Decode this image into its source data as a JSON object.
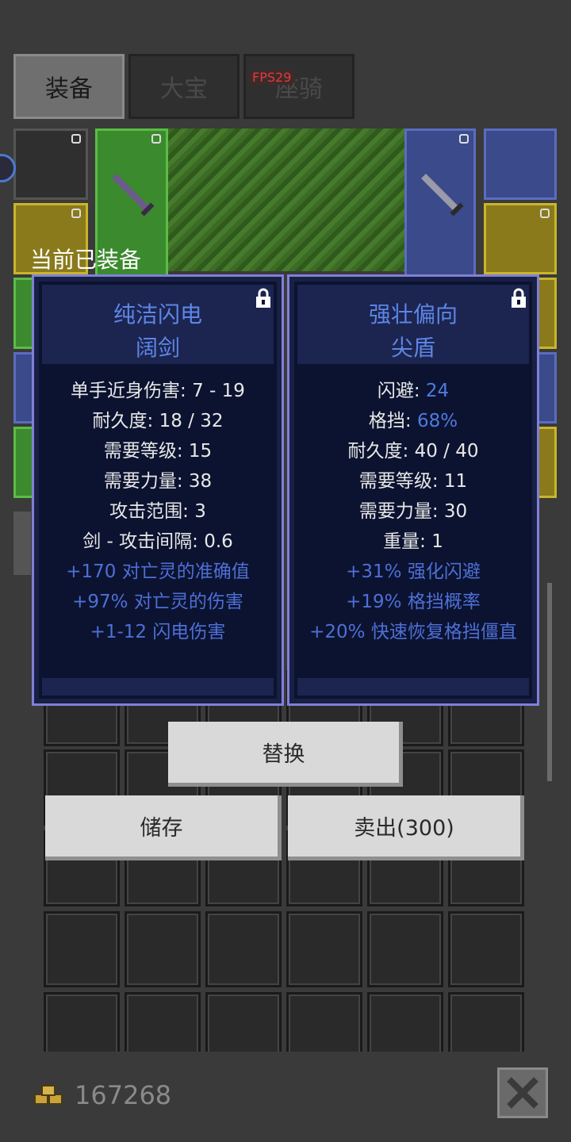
{
  "tabs": [
    {
      "label": "装备",
      "active": true
    },
    {
      "label": "大宝",
      "active": false
    },
    {
      "label": "座骑",
      "active": false
    }
  ],
  "fps": "FPS29",
  "popup": {
    "title": "当前已装备",
    "left_item": {
      "name_line1": "纯洁闪电",
      "name_line2": "阔剑",
      "stats": [
        {
          "text": "单手近身伤害: 7 - 19"
        },
        {
          "text": "耐久度: 18 / 32"
        },
        {
          "text": "需要等级: 15"
        },
        {
          "text": "需要力量: 38"
        },
        {
          "text": "攻击范围: 3"
        },
        {
          "text": "剑 - 攻击间隔: 0.6"
        }
      ],
      "mods": [
        "+170 对亡灵的准确值",
        "+97% 对亡灵的伤害",
        "+1-12 闪电伤害"
      ]
    },
    "right_item": {
      "name_line1": "强壮偏向",
      "name_line2": "尖盾",
      "stats": [
        {
          "label": "闪避: ",
          "value": "24"
        },
        {
          "label": "格挡: ",
          "value": "68%"
        },
        {
          "label": "耐久度: 40 / 40",
          "value": ""
        },
        {
          "label": "需要等级: 11",
          "value": ""
        },
        {
          "label": "需要力量: 30",
          "value": ""
        },
        {
          "label": "重量: 1",
          "value": ""
        }
      ],
      "mods": [
        "+31% 强化闪避",
        "+19% 格挡概率",
        "+20% 快速恢复格挡僵直"
      ]
    }
  },
  "buttons": {
    "replace": "替换",
    "store": "储存",
    "sell": "卖出(300)"
  },
  "gold": "167268",
  "colors": {
    "accent_blue": "#4e7ae0",
    "card_bg": "#0c1330",
    "button_bg": "#d9d9d9"
  }
}
